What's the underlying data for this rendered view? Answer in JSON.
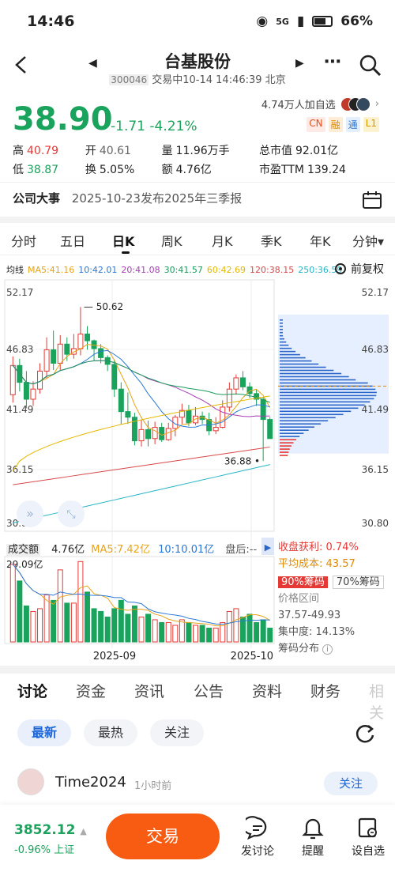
{
  "status": {
    "time": "14:46",
    "network": "5G",
    "battery": "66%"
  },
  "nav": {
    "title": "台基股份",
    "code": "300046",
    "sub": "交易中10-14 14:46:39 北京"
  },
  "quote": {
    "price": "38.90",
    "change": "-1.71",
    "change_pct": "-4.21%",
    "followers": "4.74万人加自选",
    "tags": [
      "CN",
      "融",
      "通",
      "L1"
    ],
    "stats": [
      [
        {
          "l": "高",
          "v": "40.79",
          "c": "red"
        },
        {
          "l": "开",
          "v": "40.61",
          "c": "gray"
        },
        {
          "l": "量",
          "v": "11.96万手",
          "c": "dark"
        },
        {
          "l": "总市值",
          "v": "92.01亿",
          "c": "dark"
        }
      ],
      [
        {
          "l": "低",
          "v": "38.87",
          "c": "grn"
        },
        {
          "l": "换",
          "v": "5.05%",
          "c": "dark"
        },
        {
          "l": "额",
          "v": "4.76亿",
          "c": "dark"
        },
        {
          "l": "市盈TTM",
          "v": "139.24",
          "c": "dark"
        }
      ]
    ]
  },
  "event": {
    "label": "公司大事",
    "text": "2025-10-23发布2025年三季报"
  },
  "ktabs": [
    "分时",
    "五日",
    "日K",
    "周K",
    "月K",
    "季K",
    "年K",
    "分钟▾"
  ],
  "chart_head": {
    "label": "均线",
    "ma": [
      {
        "t": "MA5:41.16",
        "color": "#e8a317"
      },
      {
        "t": "10:42.01",
        "color": "#2a78d8"
      },
      {
        "t": "20:41.08",
        "color": "#a63fb5"
      },
      {
        "t": "30:41.57",
        "color": "#1a9c5e"
      },
      {
        "t": "60:42.69",
        "color": "#e6b800"
      },
      {
        "t": "120:38.15",
        "color": "#d84a4a"
      },
      {
        "t": "250:36.59",
        "color": "#27b6c8"
      }
    ],
    "fuquan": "前复权"
  },
  "chart_data": {
    "type": "candlestick",
    "y_ticks": [
      "52.17",
      "46.83",
      "41.49",
      "36.15",
      "30.80"
    ],
    "ylim": [
      30.8,
      52.17
    ],
    "high_label": "50.62",
    "low_label": "36.88",
    "x_ticks": [
      "2025-09",
      "2025-10"
    ],
    "candles": [
      [
        42.8,
        45.4,
        42.1,
        46.2
      ],
      [
        45.4,
        43.9,
        43.1,
        46.0
      ],
      [
        43.9,
        42.4,
        41.6,
        44.9
      ],
      [
        42.4,
        43.3,
        41.8,
        44.0
      ],
      [
        43.3,
        44.9,
        42.9,
        45.6
      ],
      [
        44.9,
        46.8,
        44.2,
        47.9
      ],
      [
        46.8,
        45.6,
        45.0,
        48.5
      ],
      [
        45.6,
        47.3,
        45.0,
        48.1
      ],
      [
        47.3,
        46.4,
        45.8,
        47.9
      ],
      [
        46.4,
        46.9,
        46.0,
        48.2
      ],
      [
        46.9,
        48.2,
        46.3,
        50.6
      ],
      [
        48.2,
        47.6,
        46.8,
        48.9
      ],
      [
        47.6,
        46.9,
        45.8,
        47.7
      ],
      [
        46.9,
        46.1,
        45.6,
        47.3
      ],
      [
        46.1,
        45.5,
        44.9,
        46.3
      ],
      [
        45.5,
        43.3,
        42.6,
        45.9
      ],
      [
        43.3,
        41.3,
        40.2,
        43.9
      ],
      [
        41.3,
        40.8,
        40.2,
        43.0
      ],
      [
        40.8,
        38.7,
        38.3,
        41.2
      ],
      [
        38.7,
        39.7,
        38.2,
        40.6
      ],
      [
        39.7,
        38.9,
        38.2,
        40.5
      ],
      [
        38.9,
        39.9,
        38.4,
        40.4
      ],
      [
        39.9,
        38.8,
        38.6,
        40.3
      ],
      [
        38.8,
        39.8,
        38.7,
        40.3
      ],
      [
        39.8,
        40.8,
        39.1,
        41.0
      ],
      [
        40.8,
        41.4,
        40.2,
        42.0
      ],
      [
        41.4,
        40.3,
        40.0,
        41.9
      ],
      [
        40.3,
        40.9,
        40.1,
        41.7
      ],
      [
        40.9,
        40.6,
        40.2,
        41.3
      ],
      [
        40.6,
        39.6,
        39.2,
        41.2
      ],
      [
        39.6,
        39.9,
        39.3,
        40.8
      ],
      [
        39.9,
        41.7,
        39.8,
        42.3
      ],
      [
        41.7,
        43.3,
        41.3,
        43.9
      ],
      [
        43.3,
        44.3,
        42.8,
        44.6
      ],
      [
        44.3,
        43.5,
        43.2,
        44.9
      ],
      [
        43.5,
        42.9,
        42.5,
        43.9
      ],
      [
        42.9,
        42.4,
        41.8,
        43.3
      ],
      [
        42.4,
        40.6,
        36.9,
        42.6
      ],
      [
        40.6,
        38.9,
        38.9,
        40.8
      ]
    ],
    "volume": {
      "header": {
        "label": "成交额",
        "value": "4.76亿",
        "ma5": "MA5:7.42亿",
        "ma10": "10:10.01亿",
        "after": "盘后:--"
      },
      "max_label": "29.09亿",
      "values": [
        28,
        22,
        13,
        11,
        12,
        17,
        15,
        26,
        14,
        14,
        29,
        18,
        12,
        11,
        9,
        12,
        15,
        10,
        13,
        9,
        10,
        8,
        7,
        7,
        6,
        8,
        7,
        6,
        6,
        5,
        5,
        7,
        11,
        12,
        9,
        10,
        7,
        8,
        5
      ]
    }
  },
  "chips": {
    "profit_label": "收盘获利:",
    "profit": "0.74%",
    "avgcost_label": "平均成本:",
    "avgcost": "43.57",
    "tab90": "90%筹码",
    "tab70": "70%筹码",
    "range_label": "价格区间",
    "range": "37.57-49.93",
    "conc": "集中度: 14.13%",
    "dist_label": "筹码分布"
  },
  "news_tabs": [
    "讨论",
    "资金",
    "资讯",
    "公告",
    "资料",
    "财务",
    "相关"
  ],
  "filters": [
    "最新",
    "最热",
    "关注"
  ],
  "post": {
    "user": "Time2024",
    "time": "1小时前",
    "follow": "关注"
  },
  "bottom": {
    "index_value": "3852.12",
    "index_change": "-0.96%",
    "index_name": "上证",
    "trade": "交易",
    "discuss": "发讨论",
    "remind": "提醒",
    "setwatch": "设自选"
  }
}
